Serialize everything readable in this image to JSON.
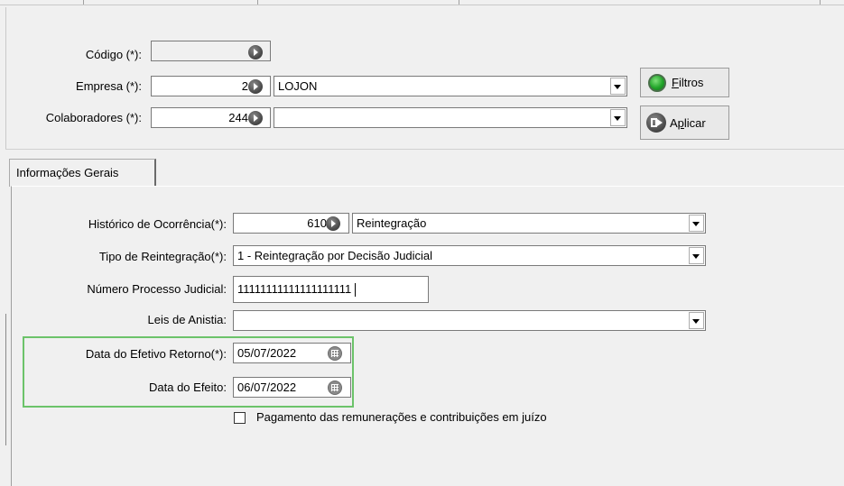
{
  "header": {
    "codigo_label": "Código (*):",
    "codigo_value": "",
    "empresa_label": "Empresa (*):",
    "empresa_code": "2",
    "empresa_name": "LOJON",
    "colaboradores_label": "Colaboradores (*):",
    "colaboradores_code": "244",
    "colaboradores_name": ""
  },
  "buttons": {
    "filtros": "Filtros",
    "aplicar_pre": "A",
    "aplicar_ul": "p",
    "aplicar_post": "licar"
  },
  "tabs": [
    {
      "label": "Informações Gerais"
    }
  ],
  "form": {
    "historico_label": "Histórico de Ocorrência(*):",
    "historico_code": "610",
    "historico_name": "Reintegração",
    "tipo_label": "Tipo de Reintegração(*):",
    "tipo_value": "1 - Reintegração por Decisão Judicial",
    "processo_label": "Número Processo Judicial:",
    "processo_value": "11111111111111111111",
    "leis_label": "Leis de Anistia:",
    "leis_value": "",
    "retorno_label": "Data do Efetivo Retorno(*):",
    "retorno_value": "05/07/2022",
    "efeito_label": "Data do Efeito:",
    "efeito_value": "06/07/2022",
    "pagamento_label": "Pagamento das remunerações e contribuições em juízo",
    "pagamento_checked": false
  },
  "colors": {
    "highlight": "#6cc36a"
  }
}
